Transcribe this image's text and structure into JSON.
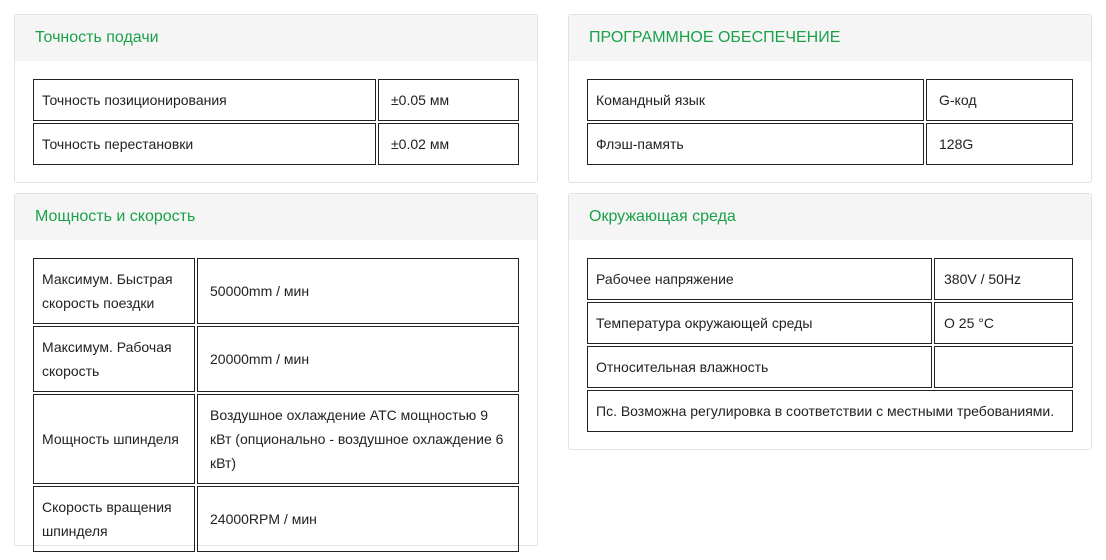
{
  "panels": {
    "feed": {
      "title": "Точность подачи",
      "rows": [
        {
          "label": "Точность позиционирования",
          "value": "±0.05 мм"
        },
        {
          "label": "Точность перестановки",
          "value": "±0.02 мм"
        }
      ]
    },
    "software": {
      "title": "ПРОГРАММНОЕ ОБЕСПЕЧЕНИЕ",
      "rows": [
        {
          "label": "Командный язык",
          "value": "G-код"
        },
        {
          "label": "Флэш-память",
          "value": "128G"
        }
      ]
    },
    "power": {
      "title": "Мощность и скорость",
      "rows": [
        {
          "label": "Максимум. Быстрая скорость поездки",
          "value": "50000mm / мин"
        },
        {
          "label": "Максимум. Рабочая скорость",
          "value": "20000mm / мин"
        },
        {
          "label": "Мощность шпинделя",
          "value": "Воздушное охлаждение ATC мощностью 9 кВт (опционально - воздушное охлаждение 6 кВт)"
        },
        {
          "label": "Скорость вращения шпинделя",
          "value": "24000RPM / мин"
        }
      ]
    },
    "environment": {
      "title": "Окружающая среда",
      "rows": [
        {
          "label": "Рабочее напряжение",
          "value": "380V / 50Hz"
        },
        {
          "label": "Температура окружающей среды",
          "value": "O 25 °C"
        },
        {
          "label": "Относительная влажность",
          "value": ""
        }
      ],
      "note": "Пс. Возможна регулировка в соответствии с местными требованиями."
    }
  }
}
